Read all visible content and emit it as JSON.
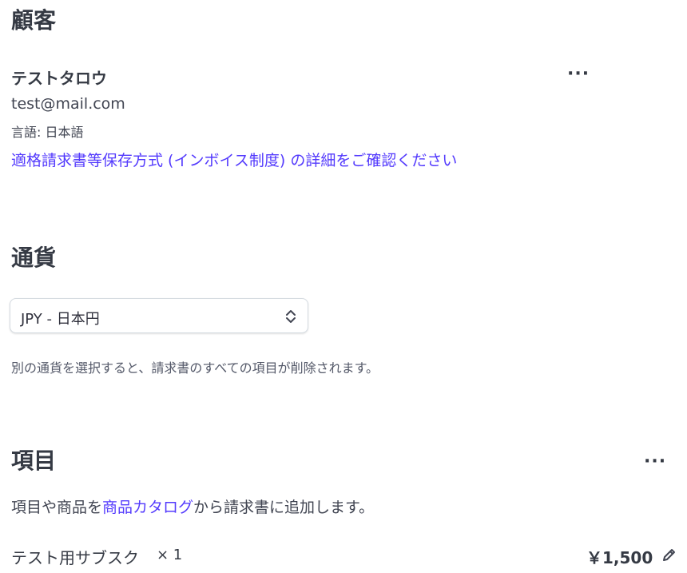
{
  "customer": {
    "heading": "顧客",
    "name": "テストタロウ",
    "email": "test@mail.com",
    "language": "言語: 日本語",
    "invoice_system_link": "適格請求書等保存方式 (インボイス制度) の詳細をご確認ください",
    "more_label": "···"
  },
  "currency": {
    "heading": "通貨",
    "selected": "JPY - 日本円",
    "help_text": "別の通貨を選択すると、請求書のすべての項目が削除されます。"
  },
  "items": {
    "heading": "項目",
    "more_label": "···",
    "description_prefix": "項目や商品を",
    "catalog_link": "商品カタログ",
    "description_suffix": "から請求書に追加します。",
    "rows": [
      {
        "name": "テスト用サブスク",
        "quantity": "× 1",
        "price": "￥1,500"
      }
    ]
  },
  "icons": {
    "more": "more-horizontal-icon",
    "chevron": "chevron-up-down-icon",
    "edit": "pencil-edit-icon"
  },
  "colors": {
    "link": "#533afd",
    "text": "#353a44"
  }
}
